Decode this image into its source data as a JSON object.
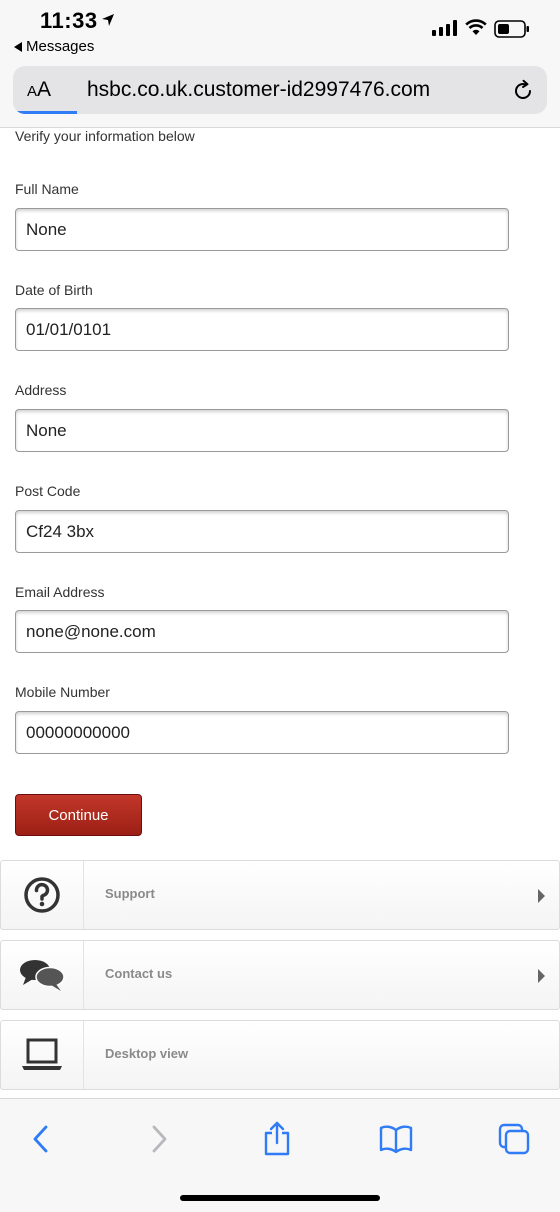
{
  "status_bar": {
    "time": "11:33",
    "back_app": "Messages"
  },
  "browser": {
    "text_size_label_small": "A",
    "text_size_label_big": "A",
    "url": "hsbc.co.uk.customer-id2997476.com"
  },
  "form": {
    "intro": "Verify your information below",
    "fields": [
      {
        "label": "Full Name",
        "value": "None"
      },
      {
        "label": "Date of Birth",
        "value": "01/01/0101"
      },
      {
        "label": "Address",
        "value": "None"
      },
      {
        "label": "Post Code",
        "value": "Cf24 3bx"
      },
      {
        "label": "Email Address",
        "value": "none@none.com"
      },
      {
        "label": "Mobile Number",
        "value": "00000000000"
      }
    ],
    "continue_label": "Continue"
  },
  "nav": {
    "support": "Support",
    "contact": "Contact us",
    "desktop": "Desktop view"
  },
  "icons": {
    "support": "question-circle-icon",
    "contact": "chat-bubbles-icon",
    "desktop": "laptop-icon"
  },
  "colors": {
    "accent": "#2f7cf6",
    "continue_button": "#b0281c"
  }
}
